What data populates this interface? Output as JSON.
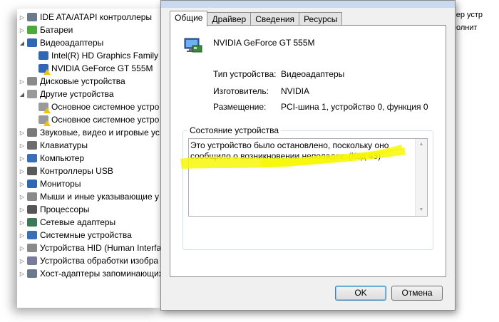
{
  "tree": {
    "items": [
      {
        "label": "IDE ATA/ATAPI контроллеры",
        "icon": "ide-controller-icon",
        "expander": "▷",
        "indent": 0
      },
      {
        "label": "Батареи",
        "icon": "battery-icon",
        "expander": "▷",
        "indent": 0
      },
      {
        "label": "Видеоадаптеры",
        "icon": "display-adapter-icon",
        "expander": "◢",
        "indent": 0
      },
      {
        "label": "Intel(R) HD Graphics Family",
        "icon": "display-adapter-icon",
        "expander": "",
        "indent": 1
      },
      {
        "label": "NVIDIA GeForce GT 555M",
        "icon": "display-adapter-warning-icon",
        "expander": "",
        "indent": 1
      },
      {
        "label": "Дисковые устройства",
        "icon": "disk-drive-icon",
        "expander": "▷",
        "indent": 0
      },
      {
        "label": "Другие устройства",
        "icon": "unknown-device-icon",
        "expander": "◢",
        "indent": 0
      },
      {
        "label": "Основное системное устро",
        "icon": "unknown-device-warning-icon",
        "expander": "",
        "indent": 1
      },
      {
        "label": "Основное системное устро",
        "icon": "unknown-device-warning-icon",
        "expander": "",
        "indent": 1
      },
      {
        "label": "Звуковые, видео и игровые ус",
        "icon": "sound-icon",
        "expander": "▷",
        "indent": 0
      },
      {
        "label": "Клавиатуры",
        "icon": "keyboard-icon",
        "expander": "▷",
        "indent": 0
      },
      {
        "label": "Компьютер",
        "icon": "computer-icon",
        "expander": "▷",
        "indent": 0
      },
      {
        "label": "Контроллеры USB",
        "icon": "usb-icon",
        "expander": "▷",
        "indent": 0
      },
      {
        "label": "Мониторы",
        "icon": "monitor-icon",
        "expander": "▷",
        "indent": 0
      },
      {
        "label": "Мыши и иные указывающие у",
        "icon": "mouse-icon",
        "expander": "▷",
        "indent": 0
      },
      {
        "label": "Процессоры",
        "icon": "processor-icon",
        "expander": "▷",
        "indent": 0
      },
      {
        "label": "Сетевые адаптеры",
        "icon": "network-adapter-icon",
        "expander": "▷",
        "indent": 0
      },
      {
        "label": "Системные устройства",
        "icon": "system-device-icon",
        "expander": "▷",
        "indent": 0
      },
      {
        "label": "Устройства HID (Human Interfa",
        "icon": "hid-icon",
        "expander": "▷",
        "indent": 0
      },
      {
        "label": "Устройства обработки изобра",
        "icon": "imaging-device-icon",
        "expander": "▷",
        "indent": 0
      },
      {
        "label": "Хост-адаптеры запоминающих",
        "icon": "storage-controller-icon",
        "expander": "▷",
        "indent": 0
      }
    ]
  },
  "right_strip": {
    "lines": [
      "чер устр",
      "полнит"
    ]
  },
  "dialog": {
    "tabs": [
      {
        "label": "Общие",
        "active": true
      },
      {
        "label": "Драйвер",
        "active": false
      },
      {
        "label": "Сведения",
        "active": false
      },
      {
        "label": "Ресурсы",
        "active": false
      }
    ],
    "device_name": "NVIDIA GeForce GT 555M",
    "properties": [
      {
        "label": "Тип устройства:",
        "value": "Видеоадаптеры"
      },
      {
        "label": "Изготовитель:",
        "value": "NVIDIA"
      },
      {
        "label": "Размещение:",
        "value": "PCI-шина 1, устройство 0, функция 0"
      }
    ],
    "status_label": "Состояние устройства",
    "status_text": "Это устройство было остановлено, поскольку оно сообщило о возникновении неполадок. (Код 43)",
    "ok_label": "OK",
    "cancel_label": "Отмена"
  },
  "colors": {
    "highlight": "#f7f707",
    "warning": "#f2c200",
    "accent": "#3c7fb1"
  }
}
